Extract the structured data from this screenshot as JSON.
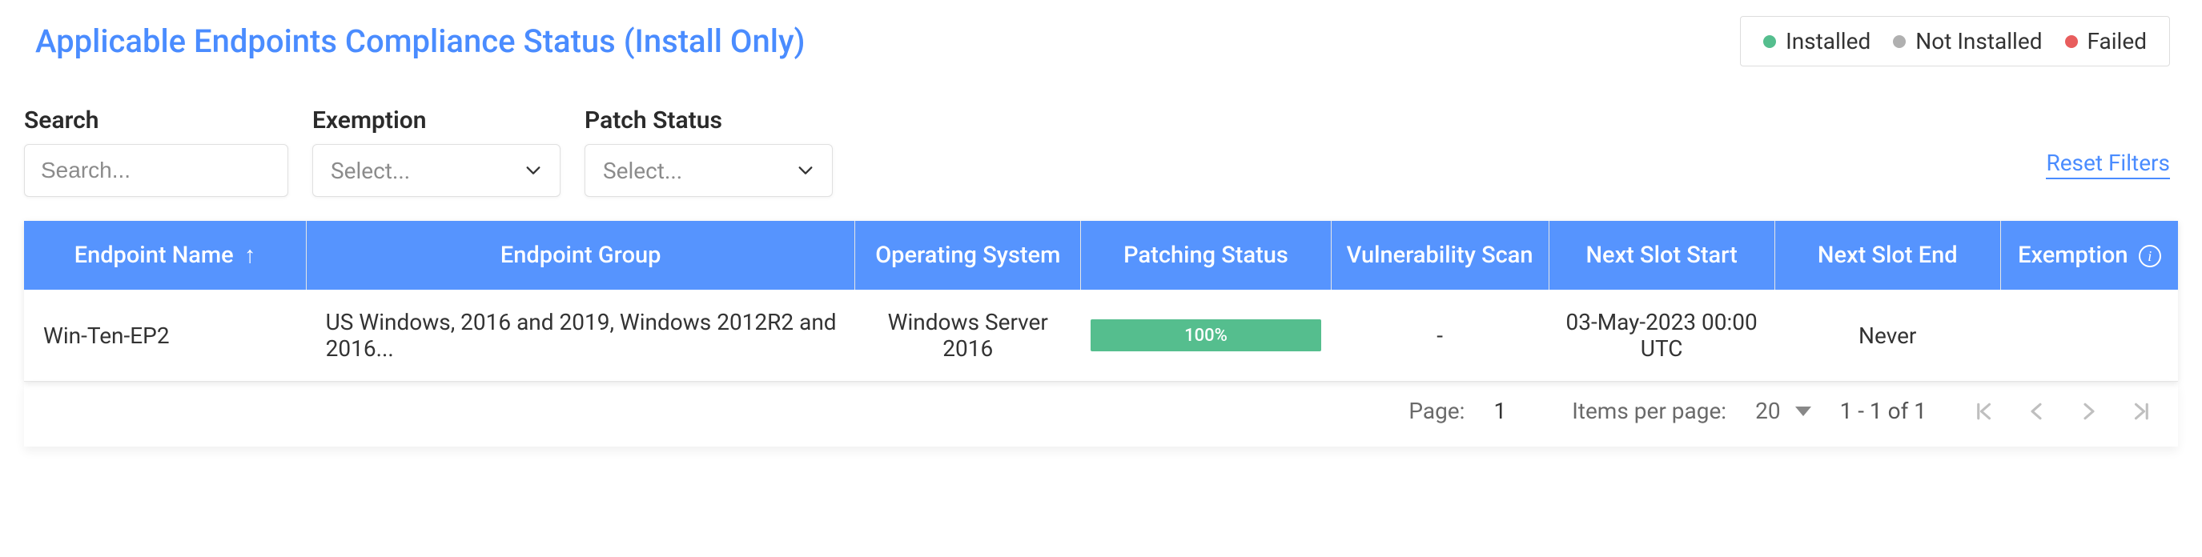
{
  "title": "Applicable Endpoints Compliance Status (Install Only)",
  "legend": {
    "installed": {
      "label": "Installed",
      "color": "#55be8e"
    },
    "not_installed": {
      "label": "Not Installed",
      "color": "#b0b0b0"
    },
    "failed": {
      "label": "Failed",
      "color": "#e85d5d"
    }
  },
  "filters": {
    "search": {
      "label": "Search",
      "placeholder": "Search..."
    },
    "exemption": {
      "label": "Exemption",
      "placeholder": "Select..."
    },
    "patch_status": {
      "label": "Patch Status",
      "placeholder": "Select..."
    },
    "reset_label": "Reset Filters"
  },
  "table": {
    "headers": {
      "endpoint_name": "Endpoint Name",
      "endpoint_group": "Endpoint Group",
      "operating_system": "Operating System",
      "patching_status": "Patching Status",
      "vulnerability_scan": "Vulnerability Scan",
      "next_slot_start": "Next Slot Start",
      "next_slot_end": "Next Slot End",
      "exemption": "Exemption"
    },
    "sort": {
      "column": "endpoint_name",
      "dir_icon": "↑"
    },
    "rows": [
      {
        "endpoint_name": "Win-Ten-EP2",
        "endpoint_group": "US Windows, 2016 and 2019, Windows 2012R2 and 2016...",
        "operating_system": "Windows Server 2016",
        "patching_status_pct": "100%",
        "vulnerability_scan": "-",
        "next_slot_start": "03-May-2023 00:00 UTC",
        "next_slot_end": "Never",
        "exemption": ""
      }
    ]
  },
  "pagination": {
    "page_label": "Page:",
    "page": "1",
    "items_per_page_label": "Items per page:",
    "items_per_page": "20",
    "range_text": "1 - 1 of 1"
  }
}
